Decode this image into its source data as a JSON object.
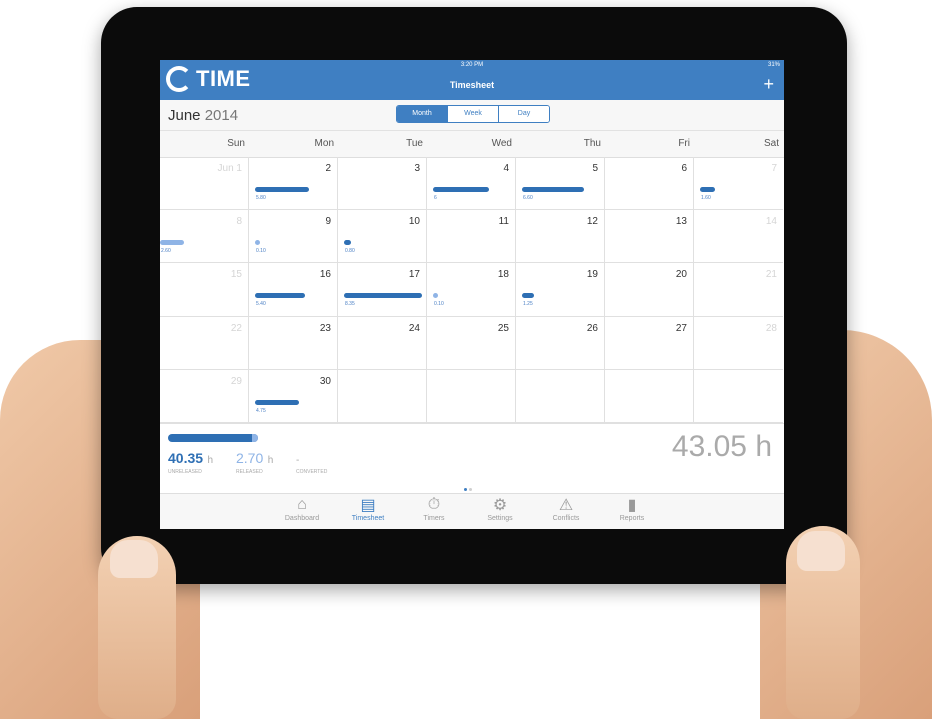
{
  "app": {
    "brand": "TIME",
    "status_time": "3:20 PM",
    "battery": "31%",
    "title": "Timesheet",
    "add_label": "+"
  },
  "subbar": {
    "month": "June",
    "year": "2014",
    "views": [
      {
        "label": "Month",
        "active": true
      },
      {
        "label": "Week",
        "active": false
      },
      {
        "label": "Day",
        "active": false
      }
    ]
  },
  "weekdays": [
    "Sun",
    "Mon",
    "Tue",
    "Wed",
    "Thu",
    "Fri",
    "Sat"
  ],
  "calendar": {
    "weeks": [
      [
        {
          "day": "Jun 1",
          "muted": true
        },
        {
          "day": "2",
          "value": "5.80",
          "hours": 5.8
        },
        {
          "day": "3"
        },
        {
          "day": "4",
          "value": "6",
          "hours": 6
        },
        {
          "day": "5",
          "value": "6.60",
          "hours": 6.6
        },
        {
          "day": "6"
        },
        {
          "day": "7",
          "muted": true,
          "value": "1.60",
          "hours": 1.6
        }
      ],
      [
        {
          "day": "8",
          "muted": true,
          "value": "2.60",
          "hours": 2.6,
          "light": true
        },
        {
          "day": "9",
          "value": "0.10",
          "hours": 0.1,
          "light": true
        },
        {
          "day": "10",
          "value": "0.80",
          "hours": 0.8
        },
        {
          "day": "11"
        },
        {
          "day": "12"
        },
        {
          "day": "13"
        },
        {
          "day": "14",
          "muted": true
        }
      ],
      [
        {
          "day": "15",
          "muted": true
        },
        {
          "day": "16",
          "value": "5.40",
          "hours": 5.4
        },
        {
          "day": "17",
          "value": "8.35",
          "hours": 8.35
        },
        {
          "day": "18",
          "value": "0.10",
          "hours": 0.1,
          "light": true
        },
        {
          "day": "19",
          "value": "1.25",
          "hours": 1.25
        },
        {
          "day": "20"
        },
        {
          "day": "21",
          "muted": true
        }
      ],
      [
        {
          "day": "22",
          "muted": true
        },
        {
          "day": "23"
        },
        {
          "day": "24"
        },
        {
          "day": "25"
        },
        {
          "day": "26"
        },
        {
          "day": "27"
        },
        {
          "day": "28",
          "muted": true
        }
      ],
      [
        {
          "day": "29",
          "muted": true
        },
        {
          "day": "30",
          "value": "4.75",
          "hours": 4.75
        },
        {
          "day": ""
        },
        {
          "day": ""
        },
        {
          "day": ""
        },
        {
          "day": ""
        },
        {
          "day": ""
        }
      ]
    ]
  },
  "summary": {
    "unreleased": {
      "value": "40.35",
      "unit": "h",
      "caption": "UNRELEASED"
    },
    "released": {
      "value": "2.70",
      "unit": "h",
      "caption": "RELEASED"
    },
    "converted": {
      "value": "-",
      "caption": "CONVERTED"
    },
    "total": "43.05 h",
    "progress_fraction": 0.94
  },
  "tabs": [
    {
      "label": "Dashboard",
      "icon": "home-icon",
      "glyph": "⌂",
      "active": false
    },
    {
      "label": "Timesheet",
      "icon": "document-icon",
      "glyph": "▤",
      "active": true
    },
    {
      "label": "Timers",
      "icon": "stopwatch-icon",
      "glyph": "⏱",
      "active": false
    },
    {
      "label": "Settings",
      "icon": "gear-icon",
      "glyph": "⚙",
      "active": false
    },
    {
      "label": "Conflicts",
      "icon": "warning-icon",
      "glyph": "⚠",
      "active": false
    },
    {
      "label": "Reports",
      "icon": "bar-chart-icon",
      "glyph": "▮",
      "active": false
    }
  ],
  "colors": {
    "accent": "#3f7fc2",
    "bar": "#2e6fb4",
    "bar_light": "#8fb4e6"
  }
}
